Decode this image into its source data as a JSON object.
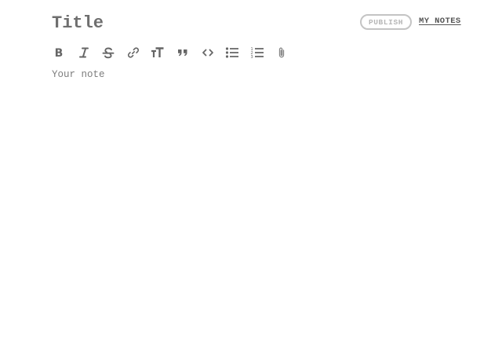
{
  "editor": {
    "title_placeholder": "Title",
    "title_value": "",
    "note_placeholder": "Your note",
    "note_value": ""
  },
  "header": {
    "publish_label": "PUBLISH",
    "my_notes_label": "MY NOTES"
  },
  "toolbar": {
    "buttons": [
      {
        "icon": "bold-icon"
      },
      {
        "icon": "italic-icon"
      },
      {
        "icon": "strikethrough-icon"
      },
      {
        "icon": "link-icon"
      },
      {
        "icon": "text-size-icon"
      },
      {
        "icon": "quote-icon"
      },
      {
        "icon": "code-icon"
      },
      {
        "icon": "bullet-list-icon"
      },
      {
        "icon": "numbered-list-icon"
      },
      {
        "icon": "attachment-icon"
      }
    ]
  },
  "colors": {
    "text": "#6f6f6f",
    "icon": "#666666",
    "publish_border": "#c4c4c4",
    "publish_text": "#b5b5b5",
    "background": "#ffffff"
  }
}
